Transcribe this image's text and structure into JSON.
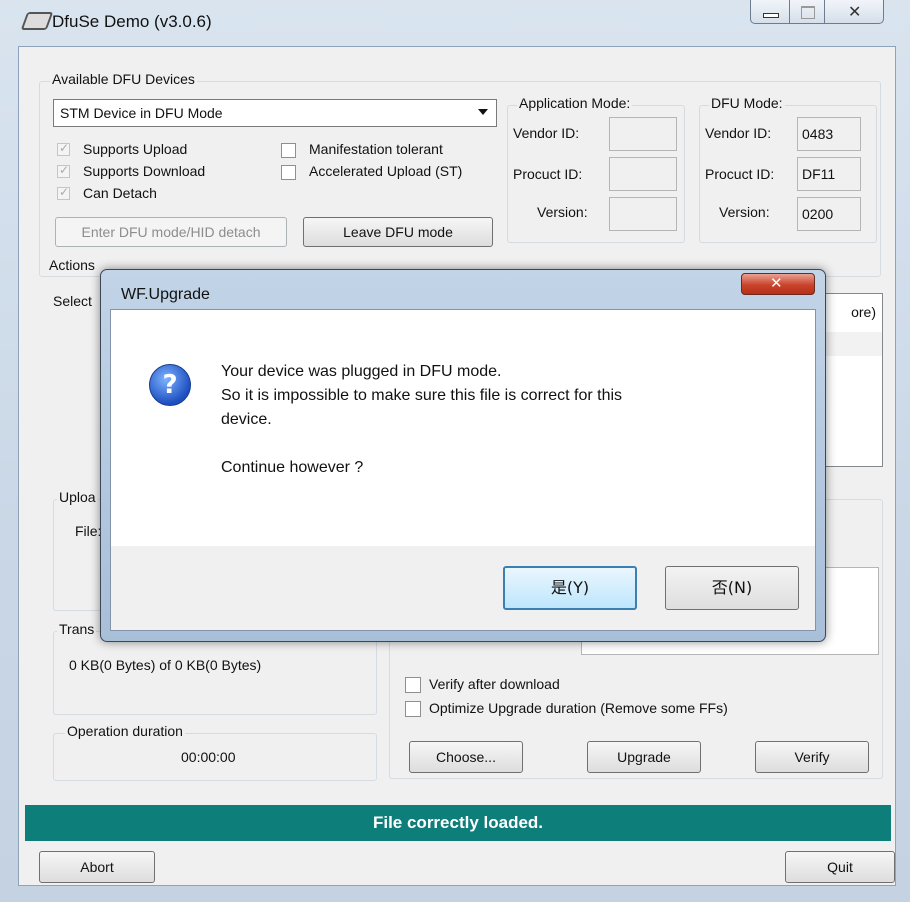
{
  "window": {
    "title": "DfuSe Demo (v3.0.6)"
  },
  "devices": {
    "group_label": "Available DFU Devices",
    "selected": "STM Device in DFU Mode",
    "supports_upload": "Supports Upload",
    "supports_download": "Supports Download",
    "can_detach": "Can Detach",
    "manifestation": "Manifestation tolerant",
    "accelerated": "Accelerated Upload (ST)",
    "enter_dfu": "Enter DFU mode/HID detach",
    "leave_dfu": "Leave DFU mode"
  },
  "app_mode": {
    "label": "Application Mode:",
    "vendor_label": "Vendor ID:",
    "product_label": "Procuct ID:",
    "version_label": "Version:",
    "vendor": "",
    "product": "",
    "version": ""
  },
  "dfu_mode": {
    "label": "DFU Mode:",
    "vendor_label": "Vendor ID:",
    "product_label": "Procuct ID:",
    "version_label": "Version:",
    "vendor": "0483",
    "product": "DF11",
    "version": "0200"
  },
  "actions": {
    "label": "Actions",
    "select_partial": "Select",
    "table_col_partial": "ore)",
    "upload_partial": "Uploa",
    "file_partial": "File:",
    "transfer_partial": "Trans",
    "transfer_text": "0 KB(0 Bytes) of 0 KB(0 Bytes)",
    "duration_label": "Operation duration",
    "duration_value": "00:00:00",
    "verify_after": "Verify after download",
    "optimize": "Optimize Upgrade duration (Remove some FFs)",
    "choose": "Choose...",
    "upgrade": "Upgrade",
    "verify": "Verify"
  },
  "status": "File correctly loaded.",
  "footer": {
    "abort": "Abort",
    "quit": "Quit"
  },
  "dialog": {
    "title": "WF.Upgrade",
    "line1": "Your device was plugged in DFU mode.",
    "line2": "So it is impossible to make sure this file is correct for this",
    "line3": "device.",
    "line4": "Continue however ?",
    "yes": "是(Y)",
    "no": "否(N)",
    "icon": "question-icon"
  },
  "colors": {
    "status_bg": "#0e7e7a",
    "accent": "#3c7fb1"
  }
}
